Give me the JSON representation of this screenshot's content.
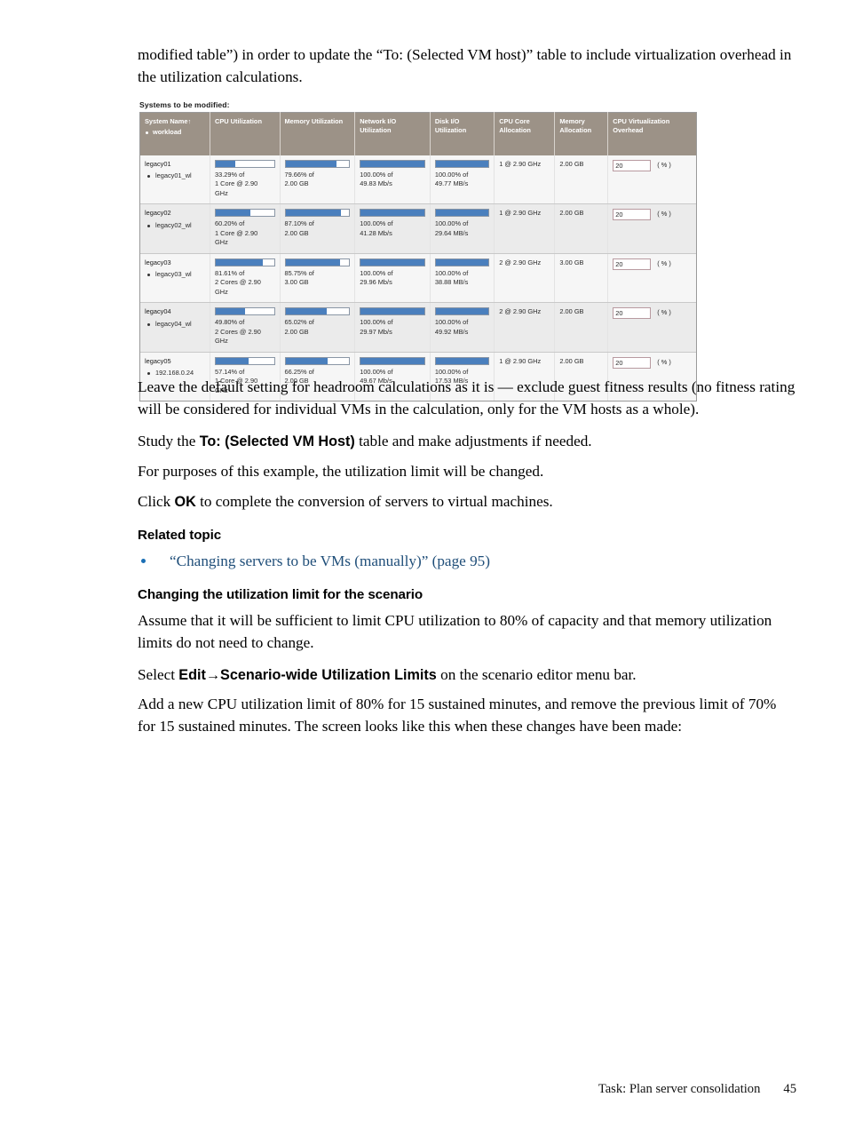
{
  "paragraphs": {
    "intro": "modified table”) in order to update the “To: (Selected VM host)” table to include virtualization overhead in the utilization calculations.",
    "headroom": "Leave the default setting for headroom calculations as it is — exclude guest fitness results (no fitness rating will be considered for individual VMs in the calculation, only for the VM hosts as a whole).",
    "study_pre": "Study the ",
    "study_bold": "To: (Selected VM Host)",
    "study_post": " table and make adjustments if needed.",
    "example": "For purposes of this example, the utilization limit will be changed.",
    "click_pre": "Click ",
    "click_bold": "OK",
    "click_post": " to complete the conversion of servers to virtual machines.",
    "assume": "Assume that it will be sufficient to limit CPU utilization to 80% of capacity and that memory utilization limits do not need to change.",
    "select_pre": "Select ",
    "select_bold": "Edit→Scenario-wide Utilization Limits",
    "select_post": " on the scenario editor menu bar.",
    "addlimit": "Add a new CPU utilization limit of 80% for 15 sustained minutes, and remove the previous limit of 70% for 15 sustained minutes. The screen looks like this when these changes have been made:"
  },
  "related": {
    "heading": "Related topic",
    "link": "“Changing servers to be VMs (manually)” (page 95)"
  },
  "section": {
    "heading": "Changing the utilization limit for the scenario"
  },
  "figure": {
    "label": "Systems to be modified:",
    "columns": [
      {
        "title": "System Name↑",
        "sub": "workload"
      },
      {
        "title": "CPU Utilization",
        "sub": ""
      },
      {
        "title": "Memory Utilization",
        "sub": ""
      },
      {
        "title": "Network I/O Utilization",
        "sub": ""
      },
      {
        "title": "Disk I/O Utilization",
        "sub": ""
      },
      {
        "title": "CPU Core Allocation",
        "sub": ""
      },
      {
        "title": "Memory Allocation",
        "sub": ""
      },
      {
        "title": "CPU Virtualization Overhead",
        "sub": ""
      }
    ],
    "bar_color": "#4a7fbd",
    "header_color": "#9c9287",
    "rows": [
      {
        "system": "legacy01",
        "workload": "legacy01_wl",
        "cpu_pct": 33.29,
        "cpu_line1": "33.29% of",
        "cpu_line2": "1 Core @ 2.90",
        "cpu_line3": "GHz",
        "mem_pct": 79.66,
        "mem_line1": "79.66% of",
        "mem_line2": "2.00  GB",
        "net_pct": 100.0,
        "net_line1": "100.00% of",
        "net_line2": "49.83 Mb/s",
        "disk_pct": 100.0,
        "disk_line1": "100.00% of",
        "disk_line2": "49.77 MB/s",
        "cores": "1 @ 2.90  GHz",
        "memalloc": "2.00  GB",
        "overhead": "20",
        "pct_label": "( % )"
      },
      {
        "system": "legacy02",
        "workload": "legacy02_wl",
        "cpu_pct": 60.2,
        "cpu_line1": "60.20% of",
        "cpu_line2": "1 Core @ 2.90",
        "cpu_line3": "GHz",
        "mem_pct": 87.1,
        "mem_line1": "87.10% of",
        "mem_line2": "2.00  GB",
        "net_pct": 100.0,
        "net_line1": "100.00% of",
        "net_line2": "41.28 Mb/s",
        "disk_pct": 100.0,
        "disk_line1": "100.00% of",
        "disk_line2": "29.64 MB/s",
        "cores": "1 @ 2.90  GHz",
        "memalloc": "2.00  GB",
        "overhead": "20",
        "pct_label": "( % )"
      },
      {
        "system": "legacy03",
        "workload": "legacy03_wl",
        "cpu_pct": 81.61,
        "cpu_line1": "81.61% of",
        "cpu_line2": "2 Cores @ 2.90",
        "cpu_line3": "GHz",
        "mem_pct": 85.75,
        "mem_line1": "85.75% of",
        "mem_line2": "3.00  GB",
        "net_pct": 100.0,
        "net_line1": "100.00% of",
        "net_line2": "29.96 Mb/s",
        "disk_pct": 100.0,
        "disk_line1": "100.00% of",
        "disk_line2": "38.88 MB/s",
        "cores": "2 @ 2.90  GHz",
        "memalloc": "3.00  GB",
        "overhead": "20",
        "pct_label": "( % )"
      },
      {
        "system": "legacy04",
        "workload": "legacy04_wl",
        "cpu_pct": 49.8,
        "cpu_line1": "49.80% of",
        "cpu_line2": "2 Cores @ 2.90",
        "cpu_line3": "GHz",
        "mem_pct": 65.02,
        "mem_line1": "65.02% of",
        "mem_line2": "2.00  GB",
        "net_pct": 100.0,
        "net_line1": "100.00% of",
        "net_line2": "29.97 Mb/s",
        "disk_pct": 100.0,
        "disk_line1": "100.00% of",
        "disk_line2": "49.92 MB/s",
        "cores": "2 @ 2.90  GHz",
        "memalloc": "2.00  GB",
        "overhead": "20",
        "pct_label": "( % )"
      },
      {
        "system": "legacy05",
        "workload": "192.168.0.24",
        "cpu_pct": 57.14,
        "cpu_line1": "57.14% of",
        "cpu_line2": "1 Core @ 2.90",
        "cpu_line3": "GHz",
        "mem_pct": 66.25,
        "mem_line1": "66.25% of",
        "mem_line2": "2.00  GB",
        "net_pct": 100.0,
        "net_line1": "100.00% of",
        "net_line2": "49.67 Mb/s",
        "disk_pct": 100.0,
        "disk_line1": "100.00% of",
        "disk_line2": "17.53 MB/s",
        "cores": "1 @ 2.90  GHz",
        "memalloc": "2.00  GB",
        "overhead": "20",
        "pct_label": "( % )"
      }
    ]
  },
  "footer": {
    "text": "Task: Plan server consolidation",
    "page": "45"
  }
}
